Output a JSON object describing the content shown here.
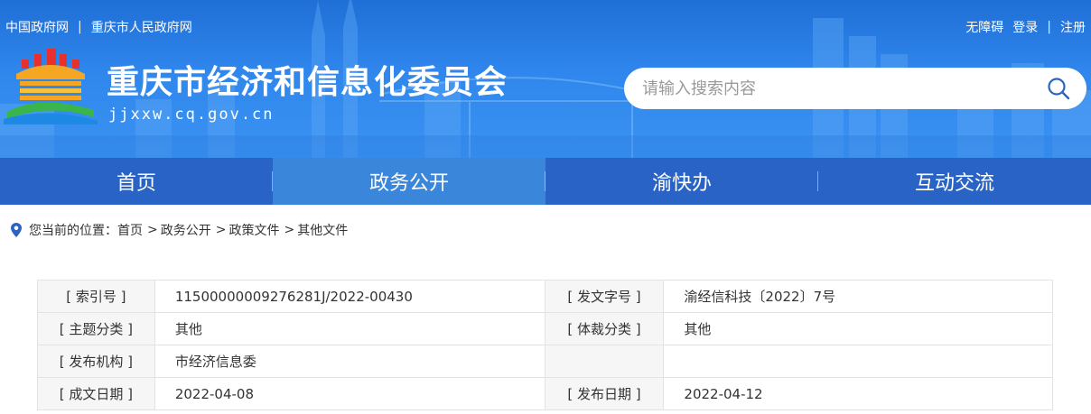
{
  "header": {
    "top_left_links": [
      "中国政府网",
      "重庆市人民政府网"
    ],
    "top_separator": "|",
    "top_right_links": [
      "无障碍",
      "登录",
      "注册"
    ],
    "title": "重庆市经济和信息化委员会",
    "domain": "jjxxw.cq.gov.cn",
    "search": {
      "placeholder": "请输入搜索内容"
    }
  },
  "nav": {
    "items": [
      "首页",
      "政务公开",
      "渝快办",
      "互动交流"
    ],
    "active_index": 1
  },
  "breadcrumb": {
    "label": "您当前的位置：",
    "items": [
      "首页",
      "政务公开",
      "政策文件",
      "其他文件"
    ],
    "separator": ">"
  },
  "info": {
    "rows": [
      {
        "k1": "[ 索引号 ]",
        "v1": "11500000009276281J/2022-00430",
        "k2": "[ 发文字号 ]",
        "v2": "渝经信科技〔2022〕7号"
      },
      {
        "k1": "[ 主题分类 ]",
        "v1": "其他",
        "k2": "[ 体裁分类 ]",
        "v2": "其他"
      },
      {
        "k1": "[ 发布机构 ]",
        "v1": "市经济信息委",
        "k2": "",
        "v2": ""
      },
      {
        "k1": "[ 成文日期 ]",
        "v1": "2022-04-08",
        "k2": "[ 发布日期 ]",
        "v2": "2022-04-12"
      }
    ]
  },
  "colors": {
    "nav_bg": "#2a63c6",
    "nav_active": "#3a86da",
    "header_top": "#1f6fd6",
    "header_bottom": "#3b93f2"
  }
}
